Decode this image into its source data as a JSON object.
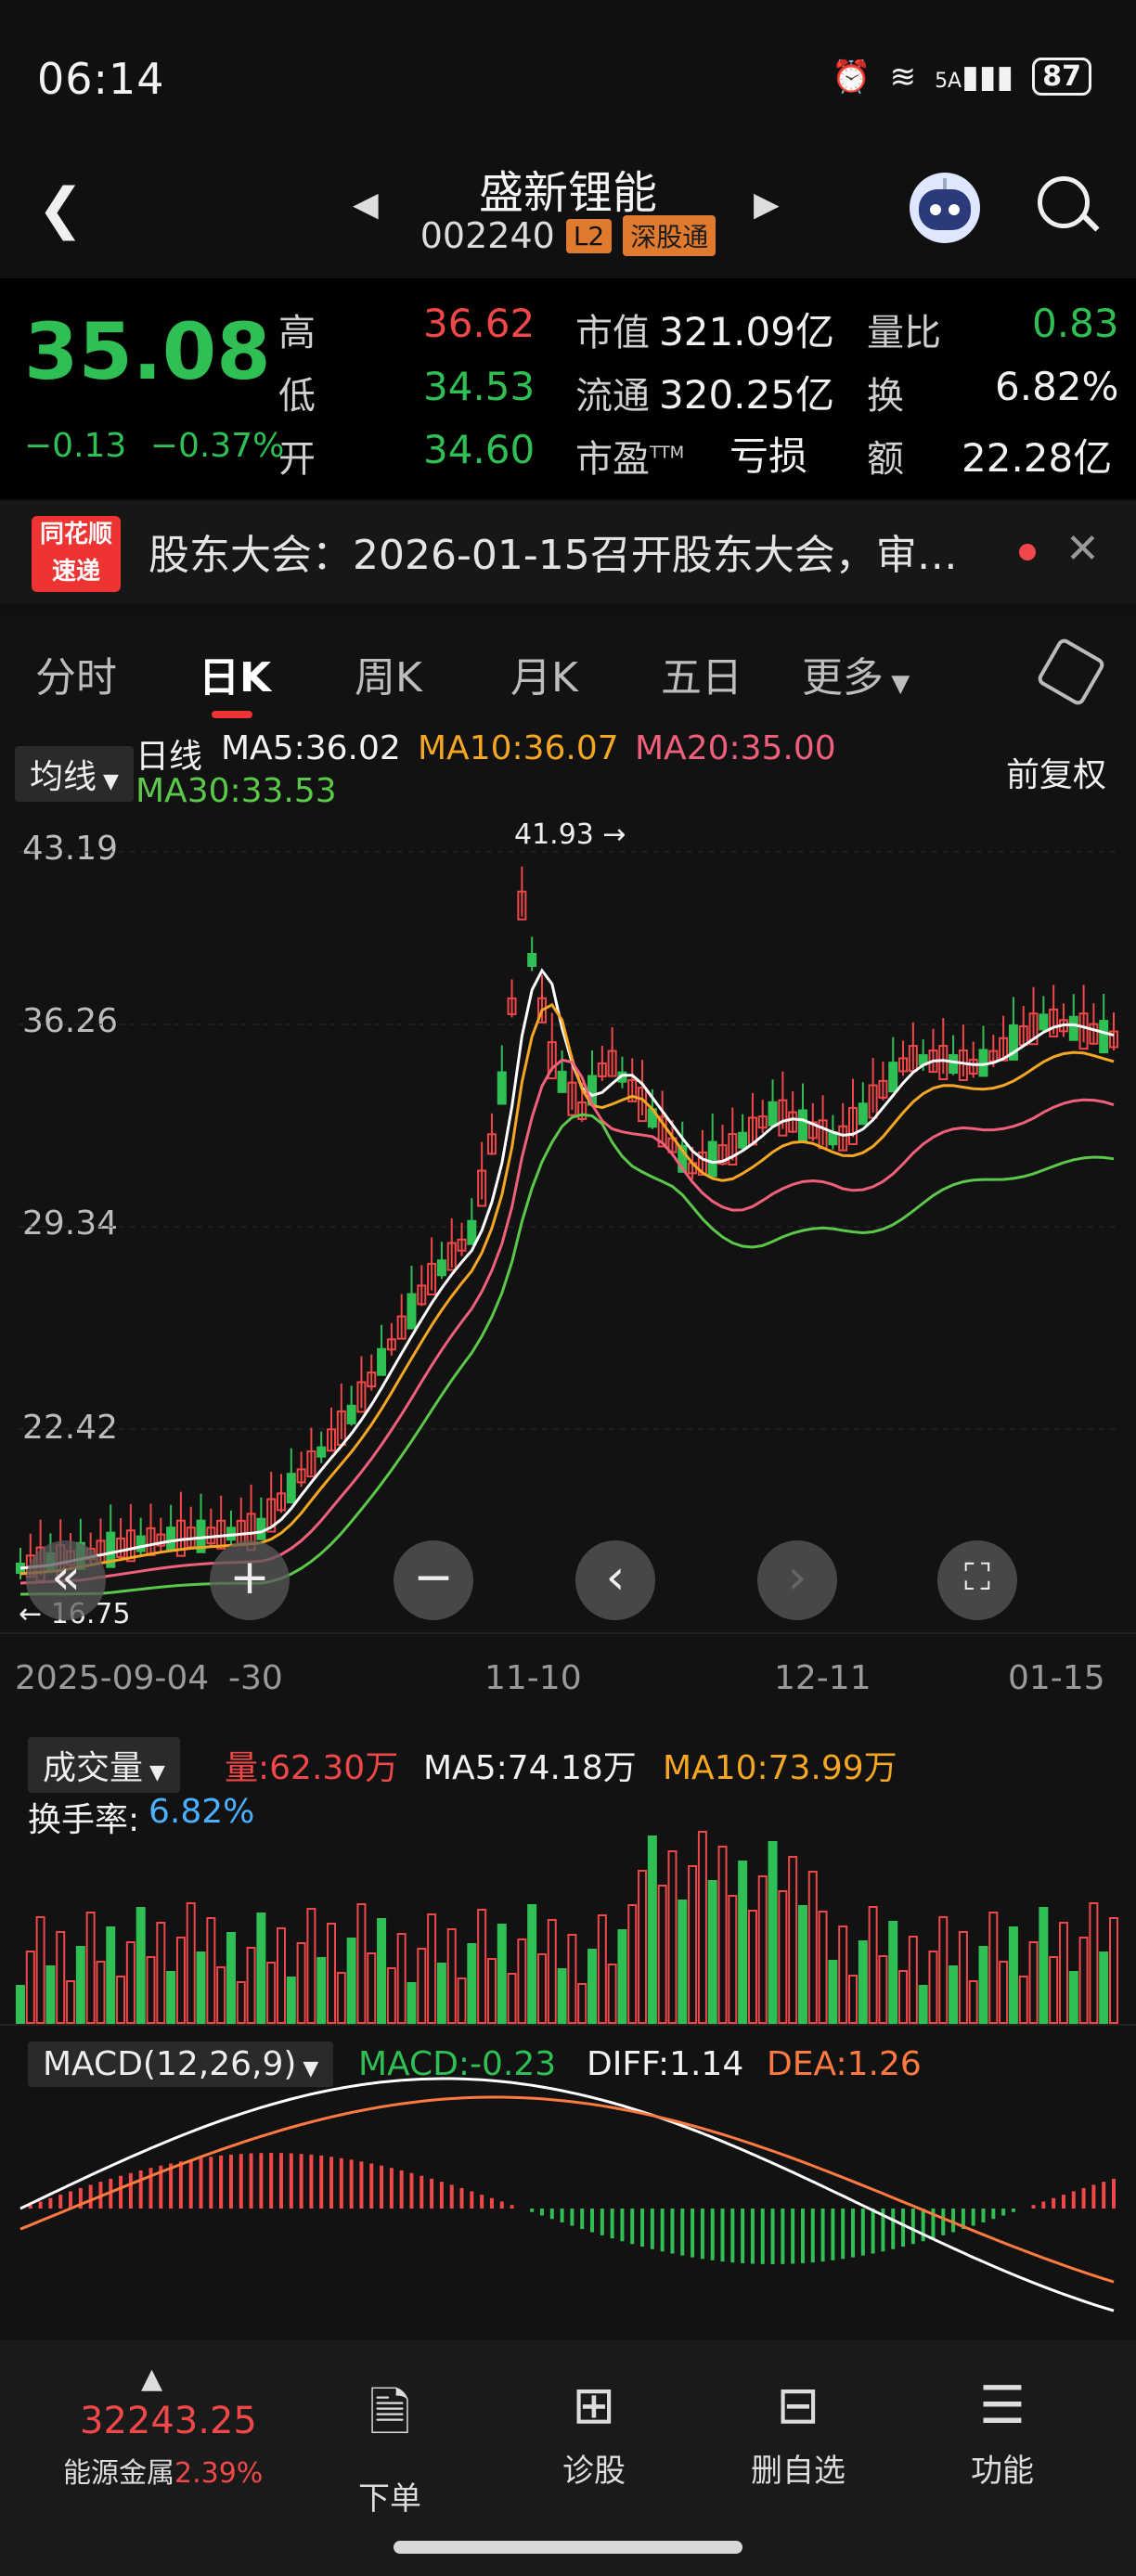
{
  "status_bar": {
    "time": "06:14",
    "battery": "87",
    "net": "5A"
  },
  "header": {
    "stock_name": "盛新锂能",
    "stock_code": "002240",
    "badge_l2": "L2",
    "badge_connect": "深股通"
  },
  "quote": {
    "price": "35.08",
    "change": "−0.13",
    "change_pct": "−0.37%",
    "high_label": "高",
    "high": "36.62",
    "low_label": "低",
    "low": "34.53",
    "open_label": "开",
    "open": "34.60",
    "mcap_label": "市值",
    "mcap": "321.09亿",
    "float_label": "流通",
    "float": "320.25亿",
    "pe_label": "市盈",
    "pe_sup": "TTM",
    "pe": "亏损",
    "vol_ratio_label": "量比",
    "vol_ratio": "0.83",
    "turnover_label": "换",
    "turnover": "6.82%",
    "amount_label": "额",
    "amount": "22.28亿"
  },
  "news": {
    "logo_top": "同花顺",
    "logo_bottom": "速递",
    "text": "股东大会：2026-01-15召开股东大会，审…"
  },
  "tabs": [
    "分时",
    "日K",
    "周K",
    "月K",
    "五日",
    "更多"
  ],
  "active_tab": "日K",
  "kline": {
    "indicator_select": "均线",
    "line_label": "日线",
    "ma5": "MA5:36.02",
    "ma10": "MA10:36.07",
    "ma20": "MA20:35.00",
    "ma30": "MA30:33.53",
    "adjust": "前复权",
    "y_ticks": [
      "43.19",
      "36.26",
      "29.34",
      "22.42"
    ],
    "high_mark": "41.93",
    "low_mark": "16.75",
    "x_ticks": [
      "2025-09-04",
      "-30",
      "11-10",
      "12-11",
      "01-15"
    ],
    "colors": {
      "ma5": "#ffffff",
      "ma10": "#f5a623",
      "ma20": "#f0607a",
      "ma30": "#5bc84a",
      "up": "#f04848",
      "down": "#2fbf55"
    }
  },
  "volume": {
    "select": "成交量",
    "vol": "量:62.30万",
    "ma5": "MA5:74.18万",
    "ma10": "MA10:73.99万",
    "turnover_label": "换手率:",
    "turnover": "6.82%"
  },
  "macd": {
    "select": "MACD(12,26,9)",
    "macd": "MACD:-0.23",
    "diff": "DIFF:1.14",
    "dea": "DEA:1.26"
  },
  "bottom_bar": {
    "index_value": "32243.25",
    "index_name": "能源金属",
    "index_pct": "2.39%",
    "items": [
      "下单",
      "诊股",
      "删自选",
      "功能"
    ]
  }
}
